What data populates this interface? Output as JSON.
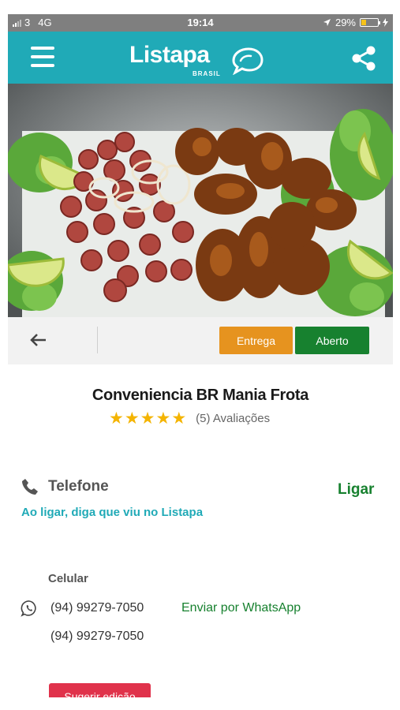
{
  "status_bar": {
    "carrier": "3",
    "network": "4G",
    "time": "19:14",
    "battery": "29%",
    "battery_level": 0.29
  },
  "header": {
    "logo": "Listapa",
    "logo_sub": "BRASIL",
    "menu_icon": "hamburger-icon",
    "share_icon": "share-icon",
    "color": "#20aab7"
  },
  "actions": {
    "back_icon": "arrow-left-icon",
    "entrega": "Entrega",
    "aberto": "Aberto"
  },
  "business": {
    "name": "Conveniencia BR Mania Frota",
    "rating_stars": 5,
    "rating_text": "(5) Avaliações"
  },
  "telefone": {
    "label": "Telefone",
    "call": "Ligar",
    "hint": "Ao ligar, diga que viu no Listapa"
  },
  "celular": {
    "label": "Celular",
    "numbers": [
      "(94) 99279-7050",
      "(94) 99279-7050"
    ],
    "whatsapp": "Enviar por WhatsApp"
  },
  "suggest": "Sugerir edição",
  "colors": {
    "teal": "#20aab7",
    "green": "#17812f",
    "orange": "#e6931f",
    "red": "#e0324b",
    "star": "#f4b400"
  }
}
